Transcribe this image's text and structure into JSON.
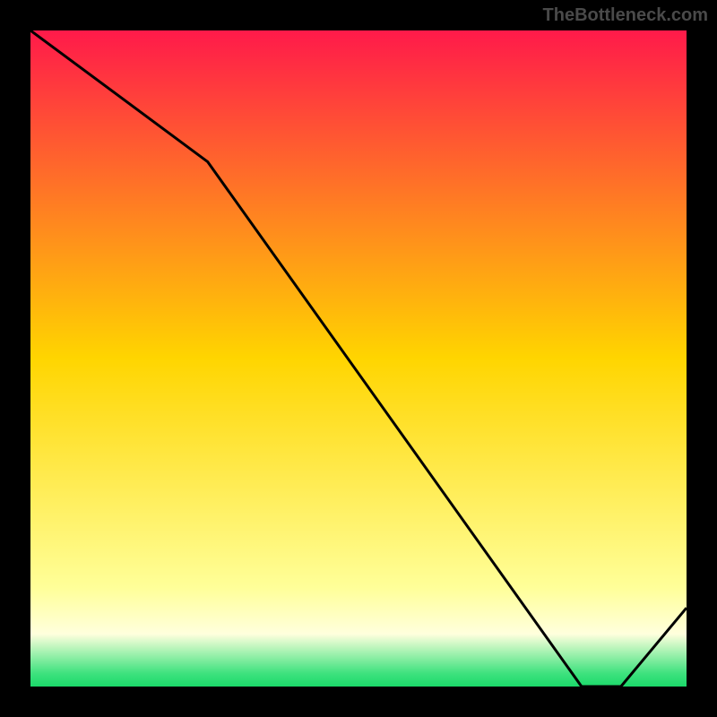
{
  "watermark": "TheBottleneck.com",
  "chart_data": {
    "type": "line",
    "title": "",
    "xlabel": "",
    "ylabel": "",
    "x": [
      0,
      27,
      84,
      90,
      100
    ],
    "values": [
      100,
      80,
      0,
      0,
      12
    ],
    "ylim": [
      0,
      100
    ],
    "xlim": [
      0,
      100
    ],
    "gradient_stops": [
      {
        "offset": 0,
        "color": "#ff1a4a"
      },
      {
        "offset": 50,
        "color": "#ffd500"
      },
      {
        "offset": 85,
        "color": "#ffff99"
      },
      {
        "offset": 92,
        "color": "#ffffdd"
      },
      {
        "offset": 98,
        "color": "#3ee27e"
      },
      {
        "offset": 100,
        "color": "#1bd96a"
      }
    ],
    "footer_label": ""
  }
}
